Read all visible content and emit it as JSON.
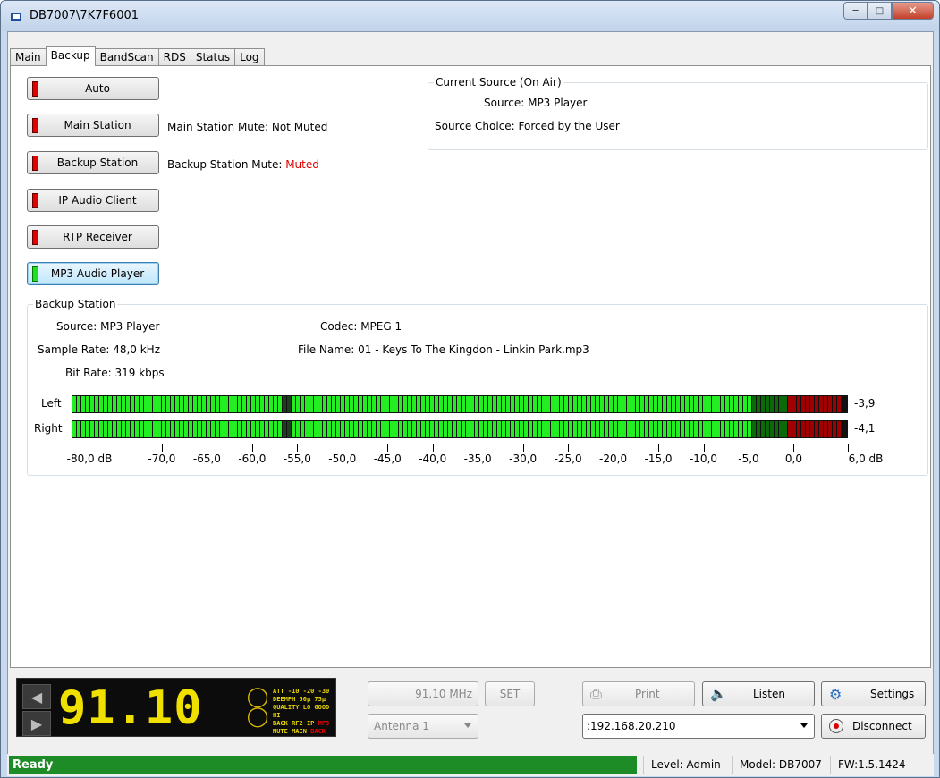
{
  "window": {
    "title": "DB7007\\7K7F6001"
  },
  "tabs": [
    "Main",
    "Backup",
    "BandScan",
    "RDS",
    "Status",
    "Log"
  ],
  "sources": [
    {
      "label": "Auto",
      "led": "red"
    },
    {
      "label": "Main Station",
      "led": "red"
    },
    {
      "label": "Backup Station",
      "led": "red"
    },
    {
      "label": "IP Audio Client",
      "led": "red"
    },
    {
      "label": "RTP Receiver",
      "led": "red"
    },
    {
      "label": "MP3 Audio Player",
      "led": "green"
    }
  ],
  "mute": {
    "main_label": "Main Station Mute:",
    "main_value": "Not Muted",
    "backup_label": "Backup Station Mute:",
    "backup_value": "Muted"
  },
  "current_source": {
    "title": "Current Source (On Air)",
    "source_label": "Source:",
    "source_value": "MP3 Player",
    "choice_label": "Source Choice:",
    "choice_value": "Forced by the User"
  },
  "backup_station": {
    "title": "Backup Station",
    "source_label": "Source:",
    "source_value": "MP3 Player",
    "samplerate_label": "Sample Rate:",
    "samplerate_value": "48,0 kHz",
    "bitrate_label": "Bit Rate:",
    "bitrate_value": "319 kbps",
    "codec_label": "Codec:",
    "codec_value": "MPEG 1",
    "filename_label": "File Name:",
    "filename_value": "01 - Keys To The Kingdon - Linkin Park.mp3"
  },
  "meters": {
    "left_label": "Left",
    "left_value": "-3,9",
    "right_label": "Right",
    "right_value": "-4,1",
    "scale_labels": [
      "-80,0 dB",
      "-70,0",
      "-65,0",
      "-60,0",
      "-55,0",
      "-50,0",
      "-45,0",
      "-40,0",
      "-35,0",
      "-30,0",
      "-25,0",
      "-20,0",
      "-15,0",
      "-10,0",
      "-5,0",
      "0,0",
      "6,0 dB"
    ],
    "left_level_db": -3.9,
    "right_level_db": -4.1
  },
  "lcd": {
    "frequency": "91.10",
    "indicators": [
      "ATT",
      "-10",
      "-20",
      "-30",
      "DEEMPH",
      "50µ",
      "75µ",
      "QUALITY",
      "LO",
      "GOOD",
      "HI",
      "BACK",
      "RF2",
      "IP",
      "MP3",
      "MUTE",
      "MAIN",
      "BACK"
    ]
  },
  "controls": {
    "frequency_field": "91,10 MHz",
    "set_button": "SET",
    "antenna_select": "Antenna 1",
    "print_button": "Print",
    "listen_button": "Listen",
    "settings_button": "Settings",
    "address_select": ":192.168.20.210",
    "disconnect_button": "Disconnect"
  },
  "status": {
    "ready": "Ready",
    "level": "Level: Admin",
    "model": "Model: DB7007",
    "fw": "FW:1.5.1424"
  }
}
